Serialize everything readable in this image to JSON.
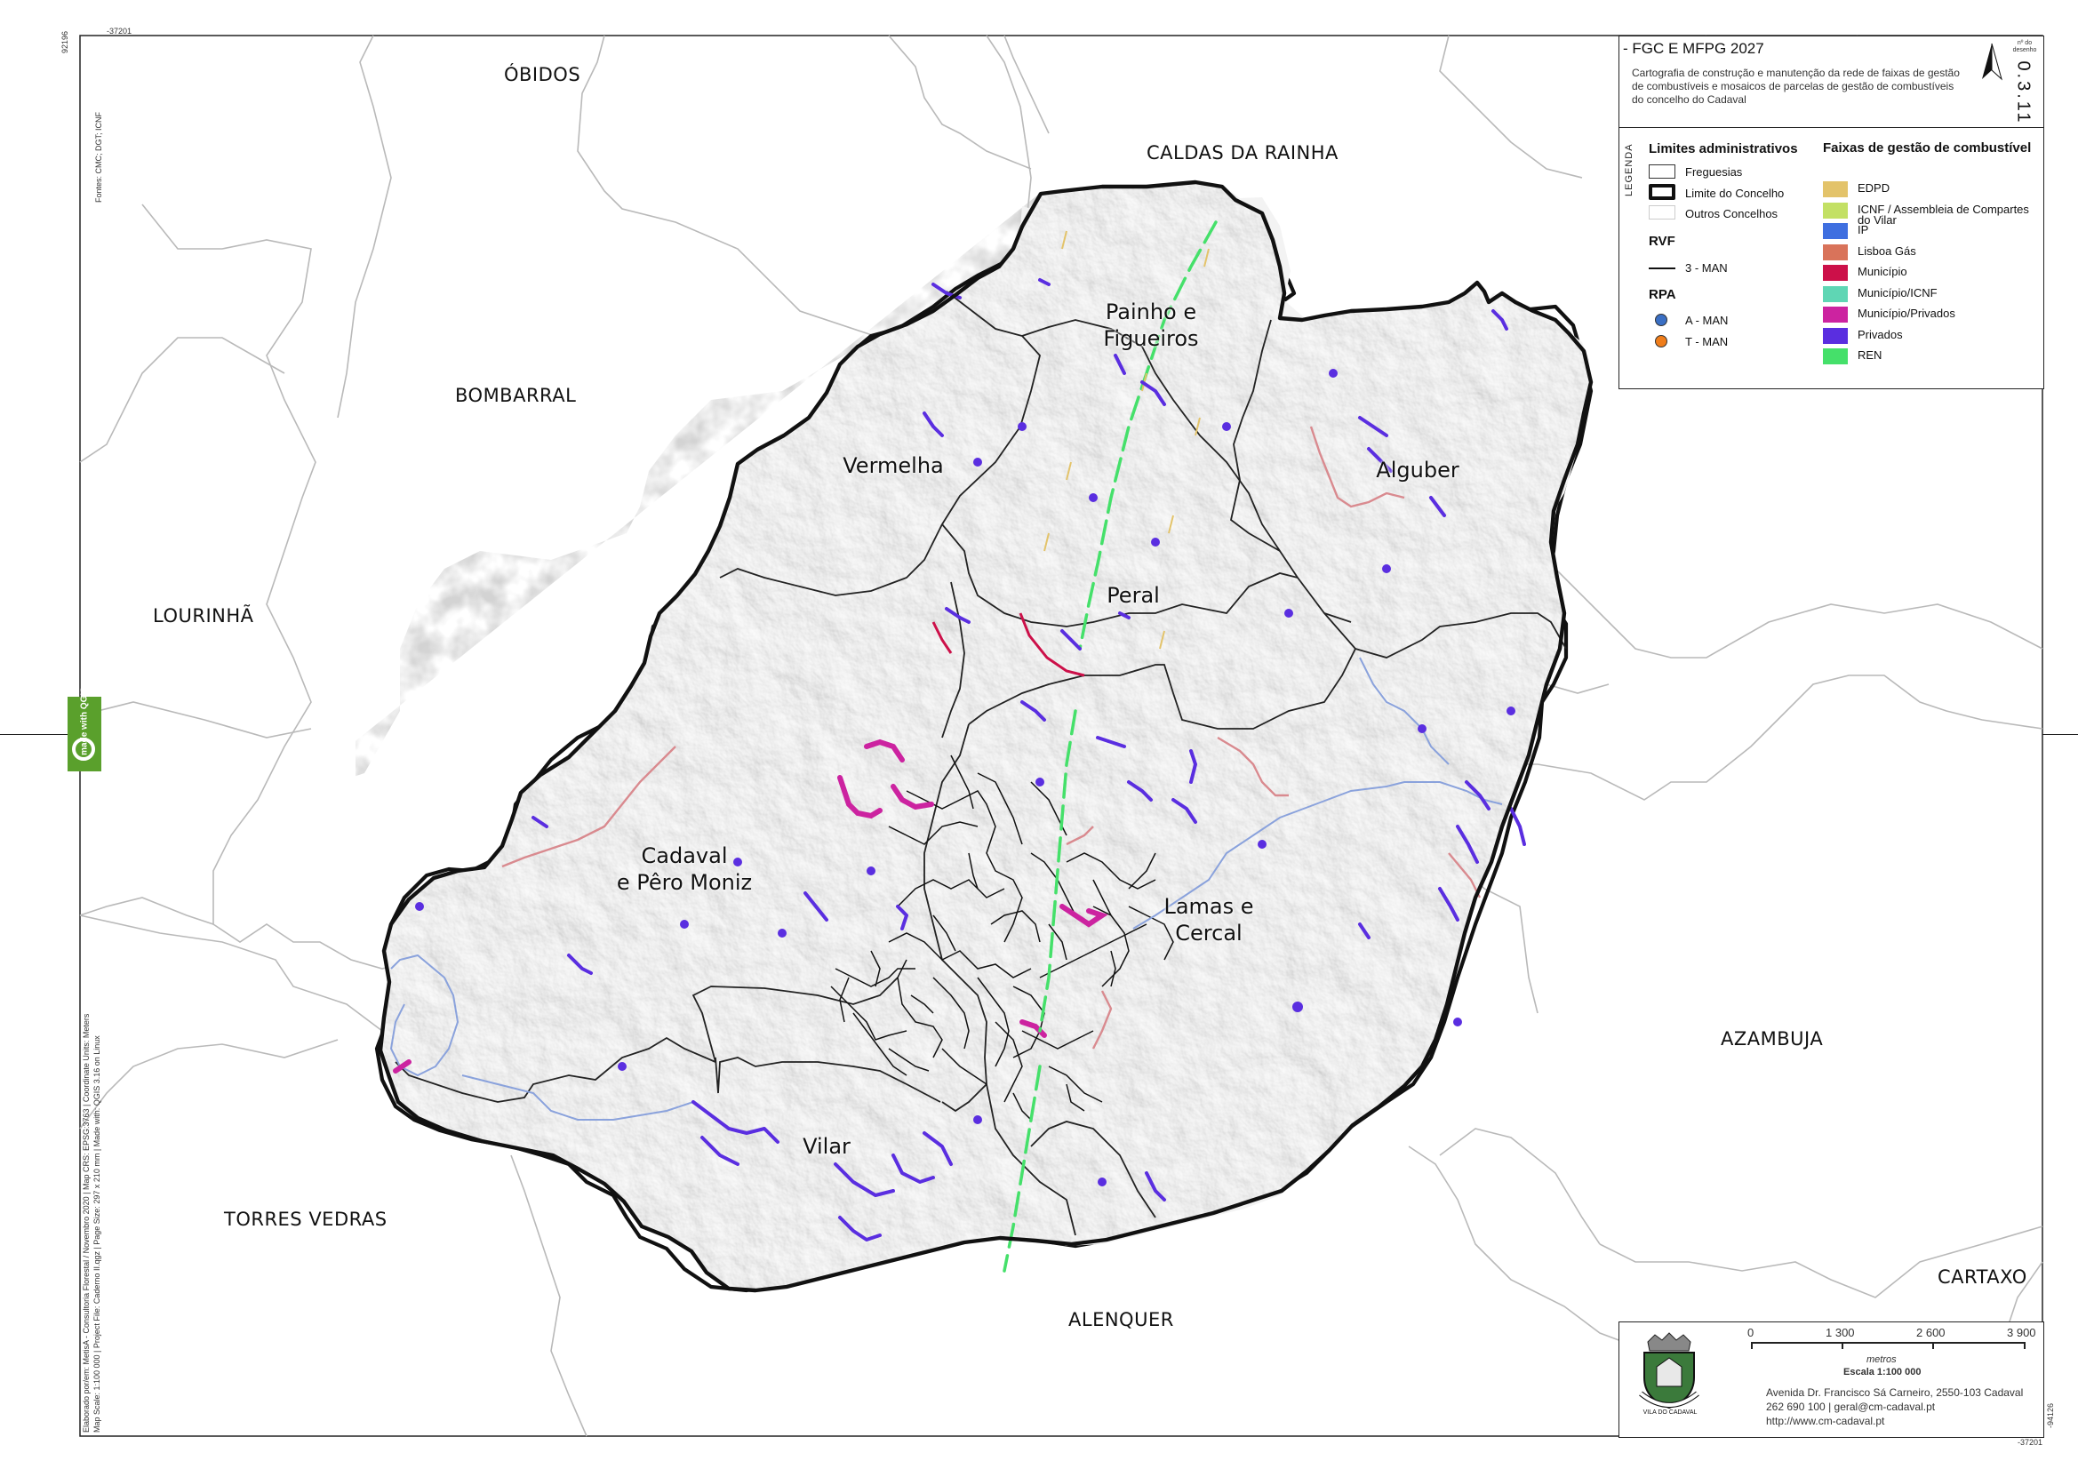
{
  "title": {
    "main": "- FGC E MFPG 2027",
    "description": "Cartografia de construção e manutenção da rede de faixas de gestão de combustíveis e mosaicos de parcelas de gestão de combustíveis do concelho do Cadaval",
    "sheet_label": "nº do desenho",
    "sheet_number": "0.3.11"
  },
  "legend": {
    "label": "LEGENDA",
    "admin_title": "Limites administrativos",
    "admin_items": [
      "Freguesias",
      "Limite do Concelho",
      "Outros Concelhos"
    ],
    "rvf_title": "RVF",
    "rvf_items": [
      "3 - MAN"
    ],
    "rpa_title": "RPA",
    "rpa_items": [
      {
        "label": "A - MAN",
        "color": "#3a6fc4"
      },
      {
        "label": "T - MAN",
        "color": "#f07d1a"
      }
    ],
    "faixas_title": "Faixas de gestão de combustível",
    "faixas_items": [
      {
        "label": "EDPD",
        "color": "#e3c36a"
      },
      {
        "label": "ICNF / Assembleia de Compartes do Vilar",
        "color": "#c3e064"
      },
      {
        "label": "IP",
        "color": "#3f6fe0"
      },
      {
        "label": "Lisboa Gás",
        "color": "#d9735a"
      },
      {
        "label": "Município",
        "color": "#cc1049"
      },
      {
        "label": "Município/ICNF",
        "color": "#5fd6b4"
      },
      {
        "label": "Município/Privados",
        "color": "#cc23a0"
      },
      {
        "label": "Privados",
        "color": "#5a2ee0"
      },
      {
        "label": "REN",
        "color": "#45e06a"
      }
    ]
  },
  "places": {
    "obidos": "ÓBIDOS",
    "caldas": "CALDAS DA RAINHA",
    "bombarral": "BOMBARRAL",
    "lourinha": "LOURINHÃ",
    "torres": "TORRES VEDRAS",
    "alenquer": "ALENQUER",
    "azambuja": "AZAMBUJA",
    "cartaxo": "CARTAXO"
  },
  "freguesias": {
    "painho": "Painho e\nFigueiros",
    "vermelha": "Vermelha",
    "alguber": "Alguber",
    "peral": "Peral",
    "cadaval": "Cadaval\ne Pêro Moniz",
    "lamas": "Lamas e\nCercal",
    "vilar": "Vilar"
  },
  "scale": {
    "ticks": [
      "0",
      "1 300",
      "2 600",
      "3 900"
    ],
    "unit": "metros",
    "label": "Escala 1:100 000"
  },
  "address": {
    "line1": "Avenida Dr. Francisco Sá Carneiro, 2550-103 Cadaval",
    "line2": "262 690 100 | geral@cm-cadaval.pt",
    "line3": "http://www.cm-cadaval.pt"
  },
  "crest_text": "VILA DO CADAVAL",
  "coords": {
    "top": "-37201",
    "left_top": "92196",
    "right_bottom": "-94126",
    "bottom_right": "-37201"
  },
  "side_notes": {
    "sources": "Fontes: CMC; DGT; ICNF",
    "credits": "Elaborado por/em: MetisA - Consultoria Florestal / Novembro 2020 | Map CRS: EPSG:3763 | Coordinate Units: Meters",
    "project": "Map Scale: 1:100 000 | Project File: Caderno II.qgz | Page Size: 297 x 210 mm | Made with: QGIS 3.16 on Linux"
  },
  "qgis_badge": "made with QGIS"
}
